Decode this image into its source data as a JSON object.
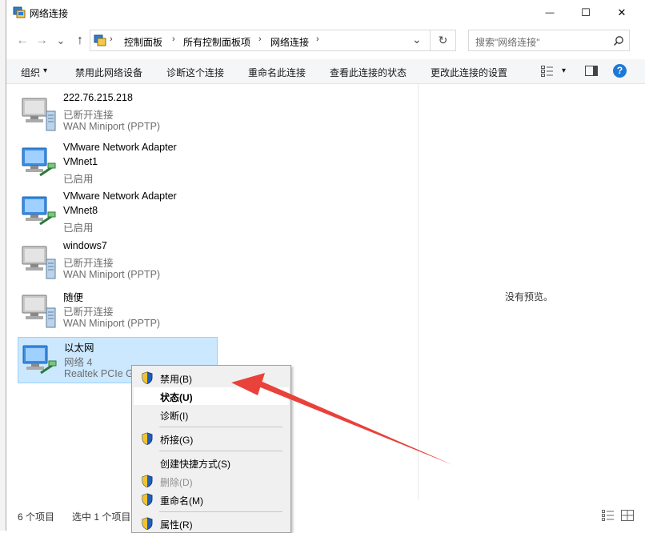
{
  "window": {
    "title": "网络连接",
    "minimize_glyph": "—",
    "maximize_glyph": "☐",
    "close_glyph": "✕"
  },
  "nav": {
    "back_glyph": "←",
    "forward_glyph": "→",
    "recent_glyph": "⌄",
    "up_glyph": "↑",
    "breadcrumbs": [
      "控制面板",
      "所有控制面板项",
      "网络连接"
    ],
    "crumb_sep": "›",
    "refresh_glyph": "↻",
    "search_placeholder": "搜索\"网络连接\""
  },
  "command_bar": {
    "organize": "组织",
    "organize_arrow": "▾",
    "disable_device": "禁用此网络设备",
    "diagnose": "诊断这个连接",
    "rename": "重命名此连接",
    "view_status": "查看此连接的状态",
    "change_settings": "更改此连接的设置",
    "view_arrow": "▾",
    "help_glyph": "?"
  },
  "connections": [
    {
      "name": "222.76.215.218",
      "status": "已断开连接",
      "device": "WAN Miniport (PPTP)",
      "kind": "wan"
    },
    {
      "name": "VMware Network Adapter",
      "status": "VMnet1",
      "device": "已启用",
      "kind": "lan"
    },
    {
      "name": "VMware Network Adapter",
      "status": "VMnet8",
      "device": "已启用",
      "kind": "lan"
    },
    {
      "name": "windows7",
      "status": "已断开连接",
      "device": "WAN Miniport (PPTP)",
      "kind": "wan"
    },
    {
      "name": "随便",
      "status": "已断开连接",
      "device": "WAN Miniport (PPTP)",
      "kind": "wan"
    },
    {
      "name": "以太网",
      "status": "网络 4",
      "device": "Realtek PCIe G",
      "kind": "lan",
      "selected": true
    }
  ],
  "preview_pane": {
    "text": "没有预览。"
  },
  "status_bar": {
    "count": "6 个项目",
    "selected": "选中 1 个项目"
  },
  "context_menu": {
    "items": [
      {
        "label": "禁用(B)",
        "shield": true
      },
      {
        "label": "状态(U)",
        "bold": true
      },
      {
        "label": "诊断(I)"
      },
      {
        "label": "桥接(G)",
        "shield": true
      },
      {
        "label": "创建快捷方式(S)"
      },
      {
        "label": "删除(D)",
        "shield": true,
        "disabled": true
      },
      {
        "label": "重命名(M)",
        "shield": true
      },
      {
        "label": "属性(R)",
        "shield": true
      }
    ]
  },
  "colors": {
    "selection": "#cce8ff",
    "help": "#1e78d7",
    "arrow": "#e8423a"
  }
}
